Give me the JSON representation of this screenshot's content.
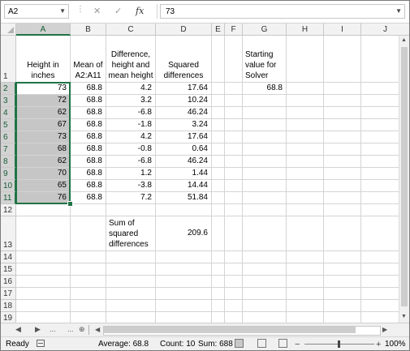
{
  "formula_bar": {
    "name_box": "A2",
    "cancel_icon": "✕",
    "enter_icon": "✓",
    "fx_label": "fx",
    "formula": "73"
  },
  "columns": [
    "A",
    "B",
    "C",
    "D",
    "E",
    "F",
    "G",
    "H",
    "I",
    "J"
  ],
  "rows": [
    "1",
    "2",
    "3",
    "4",
    "5",
    "6",
    "7",
    "8",
    "9",
    "10",
    "11",
    "12",
    "13",
    "14",
    "15",
    "16",
    "17",
    "18",
    "19"
  ],
  "headers": {
    "A1": "Height in inches",
    "B1": "Mean of A2:A11",
    "C1": "Difference, height and mean height",
    "D1": "Squared differences",
    "G1": "Starting value for Solver"
  },
  "heights": [
    "73",
    "72",
    "62",
    "67",
    "73",
    "68",
    "62",
    "70",
    "65",
    "76"
  ],
  "means": [
    "68.8",
    "68.8",
    "68.8",
    "68.8",
    "68.8",
    "68.8",
    "68.8",
    "68.8",
    "68.8",
    "68.8"
  ],
  "differences": [
    "4.2",
    "3.2",
    "-6.8",
    "-1.8",
    "4.2",
    "-0.8",
    "-6.8",
    "1.2",
    "-3.8",
    "7.2"
  ],
  "squared": [
    "17.64",
    "10.24",
    "46.24",
    "3.24",
    "17.64",
    "0.64",
    "46.24",
    "1.44",
    "14.44",
    "51.84"
  ],
  "solver_start": "68.8",
  "sum_label": "Sum of squared differences",
  "sum_value": "209.6",
  "tabs": {
    "dots1": "...",
    "dots2": "..."
  },
  "status": {
    "ready": "Ready",
    "average": "Average: 68.8",
    "count": "Count: 10",
    "sum": "Sum: 688",
    "zoom": "100%"
  }
}
